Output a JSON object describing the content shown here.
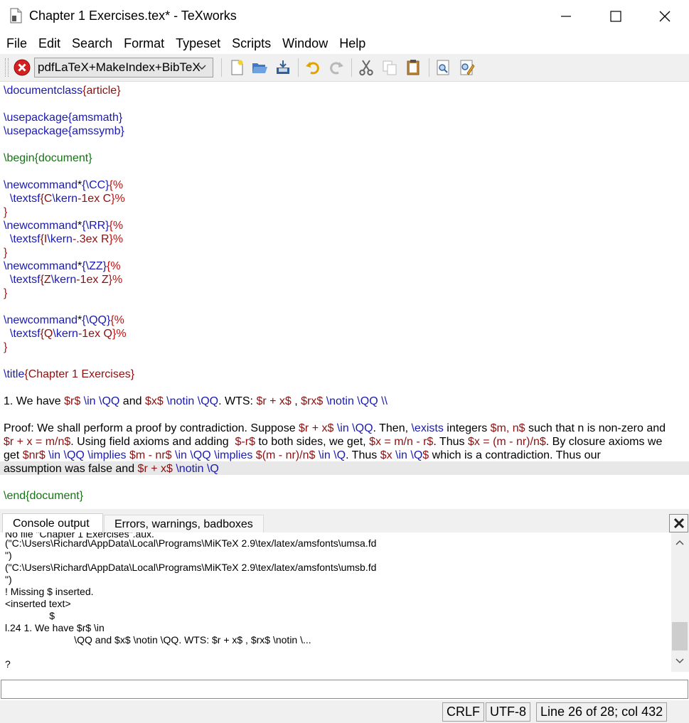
{
  "window": {
    "title": "Chapter 1 Exercises.tex* - TeXworks"
  },
  "menu": [
    "File",
    "Edit",
    "Search",
    "Format",
    "Typeset",
    "Scripts",
    "Window",
    "Help"
  ],
  "toolbar": {
    "engine": "pdfLaTeX+MakeIndex+BibTeX",
    "icons": [
      "stop-icon",
      "new-file-icon",
      "open-folder-icon",
      "save-icon",
      "undo-icon",
      "redo-icon",
      "cut-icon",
      "copy-icon",
      "paste-icon",
      "find-icon",
      "replace-icon"
    ]
  },
  "editor": {
    "l1a": "\\documentclass",
    "l1b": "{article}",
    "l3a": "\\usepackage",
    "l3b": "{amsmath}",
    "l4a": "\\usepackage",
    "l4b": "{amssymb}",
    "l6a": "\\begin",
    "l6b": "{document}",
    "c1a": "\\newcommand",
    "c1b": "*",
    "c1c": "{\\CC}",
    "c1d": "{%",
    "c1e": "  \\textsf",
    "c1f": "{C",
    "c1g": "\\kern",
    "c1h": "-1ex C",
    "c1i": "}%",
    "c1j": "}",
    "c2a": "\\newcommand",
    "c2b": "*",
    "c2c": "{\\RR}",
    "c2d": "{%",
    "c2e": "  \\textsf",
    "c2f": "{I",
    "c2g": "\\kern",
    "c2h": "-.3ex R",
    "c2i": "}%",
    "c2j": "}",
    "c3a": "\\newcommand",
    "c3b": "*",
    "c3c": "{\\ZZ}",
    "c3d": "{%",
    "c3e": "  \\textsf",
    "c3f": "{Z",
    "c3g": "\\kern",
    "c3h": "-1ex Z",
    "c3i": "}%",
    "c3j": "}",
    "c4a": "\\newcommand",
    "c4b": "*",
    "c4c": "{\\QQ}",
    "c4d": "{%",
    "c4e": "  \\textsf",
    "c4f": "{Q",
    "c4g": "\\kern",
    "c4h": "-1ex Q",
    "c4i": "}%",
    "c4j": "}",
    "t1": "\\title",
    "t2": "{Chapter 1 Exercises}",
    "w1": "1. We have ",
    "w2": "$r$",
    "w3": " \\in \\QQ",
    "w4": " and ",
    "w5": "$x$",
    "w6": " \\notin \\QQ",
    "w7": ". WTS: ",
    "w8": "$r + x$",
    "w9": " , ",
    "w10": "$rx$",
    "w11": " \\notin \\QQ \\\\",
    "p1a": "Proof: We shall perform a proof by contradiction. Suppose ",
    "p1b": "$r + x$",
    "p1c": " \\in \\QQ",
    "p1d": ". Then, ",
    "p1e": "\\exists",
    "p1f": " integers ",
    "p1g": "$m, n$",
    "p1h": " such that n is non-zero and",
    "p2a": "$r + x = m/n$",
    "p2b": ". Using field axioms and adding  ",
    "p2c": "$-r$",
    "p2d": " to both sides, we get, ",
    "p2e": "$x = m/n - r$",
    "p2f": ". Thus ",
    "p2g": "$x = (m - nr)/n$",
    "p2h": ". By closure axioms we",
    "p3a": "get ",
    "p3b": "$nr$",
    "p3c": " \\in \\QQ \\implies",
    "p3d": " $m - nr$",
    "p3e": " \\in \\QQ \\implies",
    "p3f": " $(m - nr)/n$",
    "p3g": " \\in \\Q",
    "p3h": ". Thus ",
    "p3i": "$x",
    "p3j": " \\in \\Q",
    "p3k": "$",
    "p3l": " which is a contradiction. Thus our",
    "p4a": "assumption was false and ",
    "p4b": "$r + x$",
    "p4c": " \\notin \\Q",
    "e1": "\\end",
    "e2": "{document}"
  },
  "console": {
    "tabs": [
      "Console output",
      "Errors, warnings, badboxes"
    ],
    "lines": [
      "No file \"Chapter 1 Exercises\".aux.",
      "(\"C:\\Users\\Richard\\AppData\\Local\\Programs\\MiKTeX 2.9\\tex/latex/amsfonts\\umsa.fd",
      "\")",
      "(\"C:\\Users\\Richard\\AppData\\Local\\Programs\\MiKTeX 2.9\\tex/latex/amsfonts\\umsb.fd",
      "\")",
      "! Missing $ inserted.",
      "<inserted text>",
      "                $",
      "l.24 1. We have $r$ \\in",
      "                         \\QQ and $x$ \\notin \\QQ. WTS: $r + x$ , $rx$ \\notin \\...",
      "",
      "?"
    ]
  },
  "status": {
    "line_ending": "CRLF",
    "encoding": "UTF-8",
    "position": "Line 26 of 28; col 432"
  }
}
